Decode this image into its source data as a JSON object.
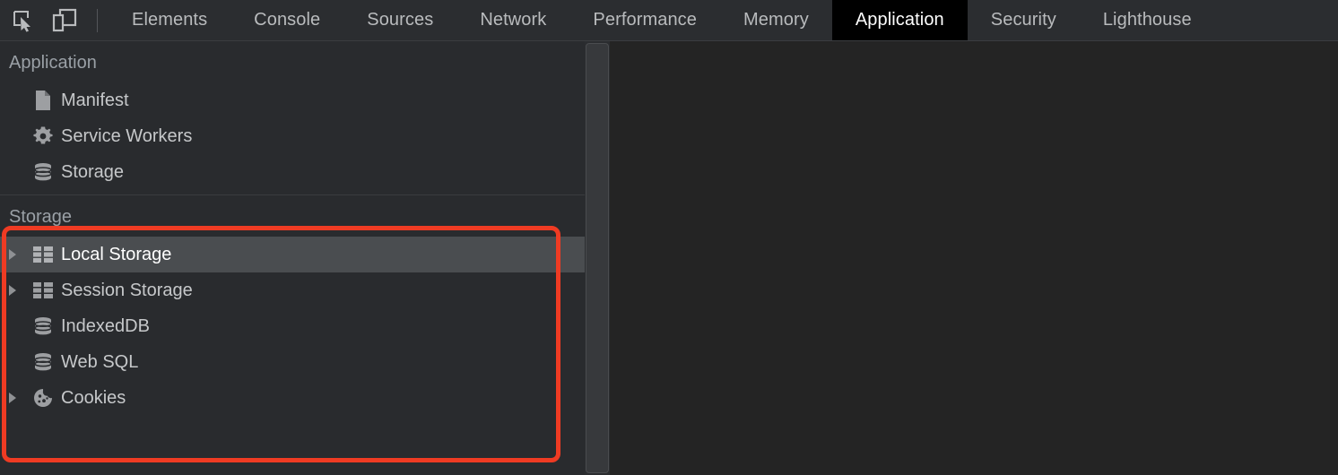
{
  "toolbar": {
    "inspect_icon": "inspect-element-icon",
    "device_icon": "device-toolbar-icon"
  },
  "tabs": [
    {
      "label": "Elements",
      "selected": false
    },
    {
      "label": "Console",
      "selected": false
    },
    {
      "label": "Sources",
      "selected": false
    },
    {
      "label": "Network",
      "selected": false
    },
    {
      "label": "Performance",
      "selected": false
    },
    {
      "label": "Memory",
      "selected": false
    },
    {
      "label": "Application",
      "selected": true
    },
    {
      "label": "Security",
      "selected": false
    },
    {
      "label": "Lighthouse",
      "selected": false
    }
  ],
  "sidebar": {
    "application_section": {
      "title": "Application",
      "items": [
        {
          "label": "Manifest",
          "icon": "document-icon",
          "expandable": false,
          "selected": false
        },
        {
          "label": "Service Workers",
          "icon": "gear-icon",
          "expandable": false,
          "selected": false
        },
        {
          "label": "Storage",
          "icon": "database-icon",
          "expandable": false,
          "selected": false
        }
      ]
    },
    "storage_section": {
      "title": "Storage",
      "items": [
        {
          "label": "Local Storage",
          "icon": "table-icon",
          "expandable": true,
          "selected": true
        },
        {
          "label": "Session Storage",
          "icon": "table-icon",
          "expandable": true,
          "selected": false
        },
        {
          "label": "IndexedDB",
          "icon": "database-icon",
          "expandable": false,
          "selected": false
        },
        {
          "label": "Web SQL",
          "icon": "database-icon",
          "expandable": false,
          "selected": false
        },
        {
          "label": "Cookies",
          "icon": "cookie-icon",
          "expandable": true,
          "selected": false
        }
      ]
    }
  },
  "annotation": {
    "highlight_color": "#ef3b23"
  },
  "colors": {
    "tabbar_background": "#2b2d30",
    "sidebar_background": "#292b2e",
    "main_background": "#242424",
    "selected_tab_background": "#000000",
    "selected_row_background": "#4a4d50",
    "text_primary": "#c6c8ca",
    "text_muted": "#9aa0a6",
    "icon_fill": "#9d9fa2"
  }
}
